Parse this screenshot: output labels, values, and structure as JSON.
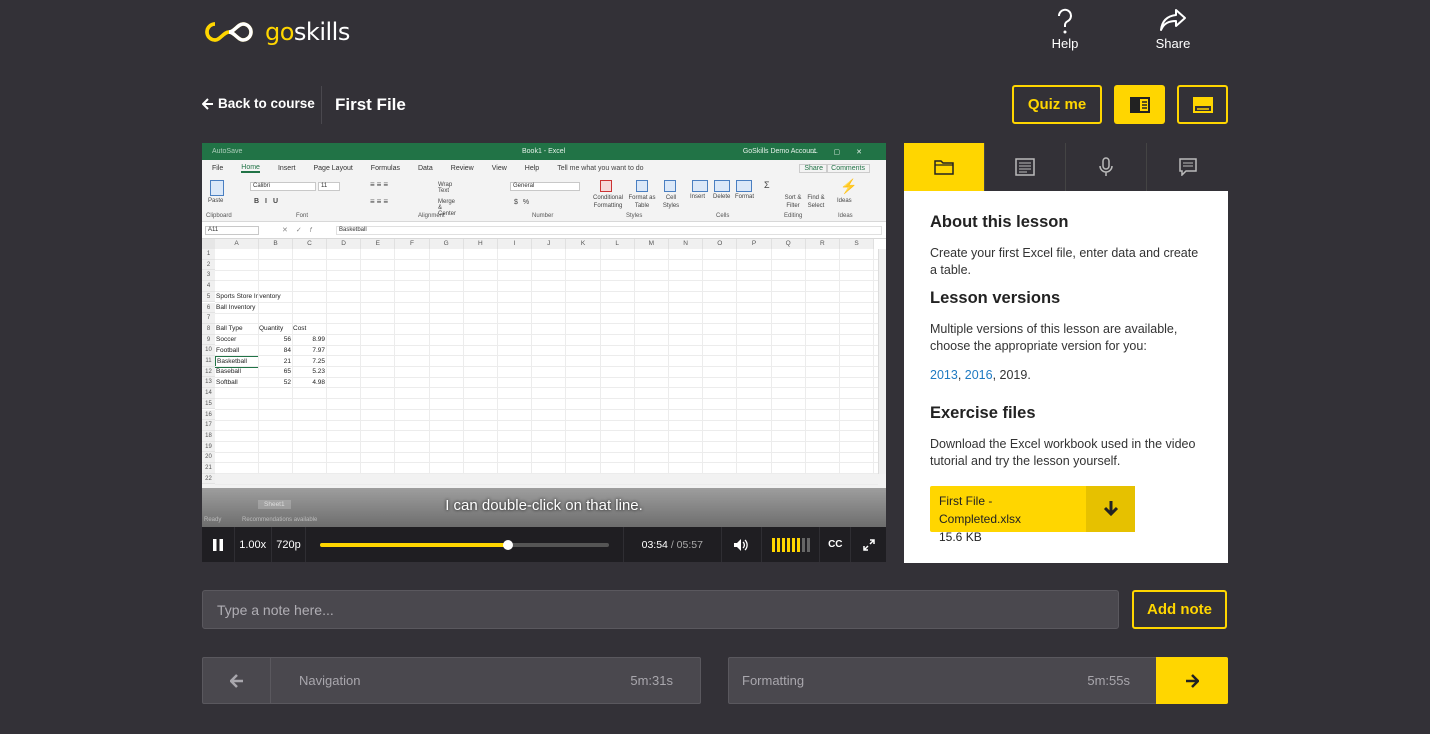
{
  "brand": {
    "go": "go",
    "skills": "skills"
  },
  "header": {
    "help_label": "Help",
    "share_label": "Share"
  },
  "lesson": {
    "back_label": "Back to course",
    "title": "First File"
  },
  "toolbar": {
    "quiz_label": "Quiz me"
  },
  "excel": {
    "autosave": "AutoSave",
    "window_title": "Book1 - Excel",
    "account": "GoSkills Demo Account",
    "menu": [
      "File",
      "Home",
      "Insert",
      "Page Layout",
      "Formulas",
      "Data",
      "Review",
      "View",
      "Help"
    ],
    "tell_me": "Tell me what you want to do",
    "share": "Share",
    "comments": "Comments",
    "ribbon": {
      "paste": "Paste",
      "clipboard": "Clipboard",
      "font_name": "Calibri",
      "font_size": "11",
      "font": "Font",
      "wrap_text": "Wrap Text",
      "merge_center": "Merge & Center",
      "alignment": "Alignment",
      "number_format": "General",
      "number": "Number",
      "conditional": "Conditional Formatting",
      "format_table": "Format as Table",
      "cell_styles": "Cell Styles",
      "styles": "Styles",
      "insert": "Insert",
      "delete": "Delete",
      "format": "Format",
      "cells": "Cells",
      "sort": "Sort & Filter",
      "find": "Find & Select",
      "editing": "Editing",
      "ideas": "Ideas",
      "ideas_group": "Ideas"
    },
    "name_box": "A11",
    "formula_value": "Basketball",
    "columns": [
      "A",
      "B",
      "C",
      "D",
      "E",
      "F",
      "G",
      "H",
      "I",
      "J",
      "K",
      "L",
      "M",
      "N",
      "O",
      "P",
      "Q",
      "R",
      "S"
    ],
    "rows": [
      "1",
      "2",
      "3",
      "4",
      "5",
      "6",
      "7",
      "8",
      "9",
      "10",
      "11",
      "12",
      "13",
      "14",
      "15",
      "16",
      "17",
      "18",
      "19",
      "20",
      "21",
      "22"
    ],
    "cells": {
      "title": "Sports Store Inventory",
      "subtitle": "Ball Inventory",
      "h_type": "Ball Type",
      "h_qty": "Quantity",
      "h_cost": "Cost",
      "data": [
        {
          "type": "Soccer",
          "qty": "56",
          "cost": "8.99"
        },
        {
          "type": "Football",
          "qty": "84",
          "cost": "7.97"
        },
        {
          "type": "Basketball",
          "qty": "21",
          "cost": "7.25"
        },
        {
          "type": "Baseball",
          "qty": "65",
          "cost": "5.23"
        },
        {
          "type": "Softball",
          "qty": "52",
          "cost": "4.98"
        }
      ]
    },
    "sheet_tab": "Sheet1",
    "status_ready": "Ready",
    "status_rec": "Recommendations available"
  },
  "player": {
    "caption": "I can double-click on that line.",
    "speed": "1.00x",
    "quality": "720p",
    "time_current": "03:54",
    "time_sep": "/",
    "time_total": "05:57",
    "progress": 0.65,
    "cc": "CC",
    "volume_bars_on": 6,
    "volume_bars_total": 8
  },
  "panel": {
    "about_title": "About this lesson",
    "about_text": "Create your first Excel file, enter data and create a table.",
    "versions_title": "Lesson versions",
    "versions_text": "Multiple versions of this lesson are available, choose the appropriate version for you:",
    "version_2013": "2013",
    "version_2016": "2016",
    "version_2019": "2019",
    "sep": ", ",
    "end": ".",
    "exercise_title": "Exercise files",
    "exercise_text": "Download the Excel workbook used in the video tutorial and try the lesson yourself.",
    "file_name": "First File - Completed.xlsx",
    "file_size": "15.6 KB"
  },
  "notes": {
    "placeholder": "Type a note here...",
    "add_label": "Add note"
  },
  "nav": {
    "prev_title": "Navigation",
    "prev_duration": "5m:31s",
    "next_title": "Formatting",
    "next_duration": "5m:55s"
  },
  "colors": {
    "accent": "#ffd600",
    "background": "#333137",
    "excel_green": "#217346",
    "link": "#1f7ac2"
  }
}
